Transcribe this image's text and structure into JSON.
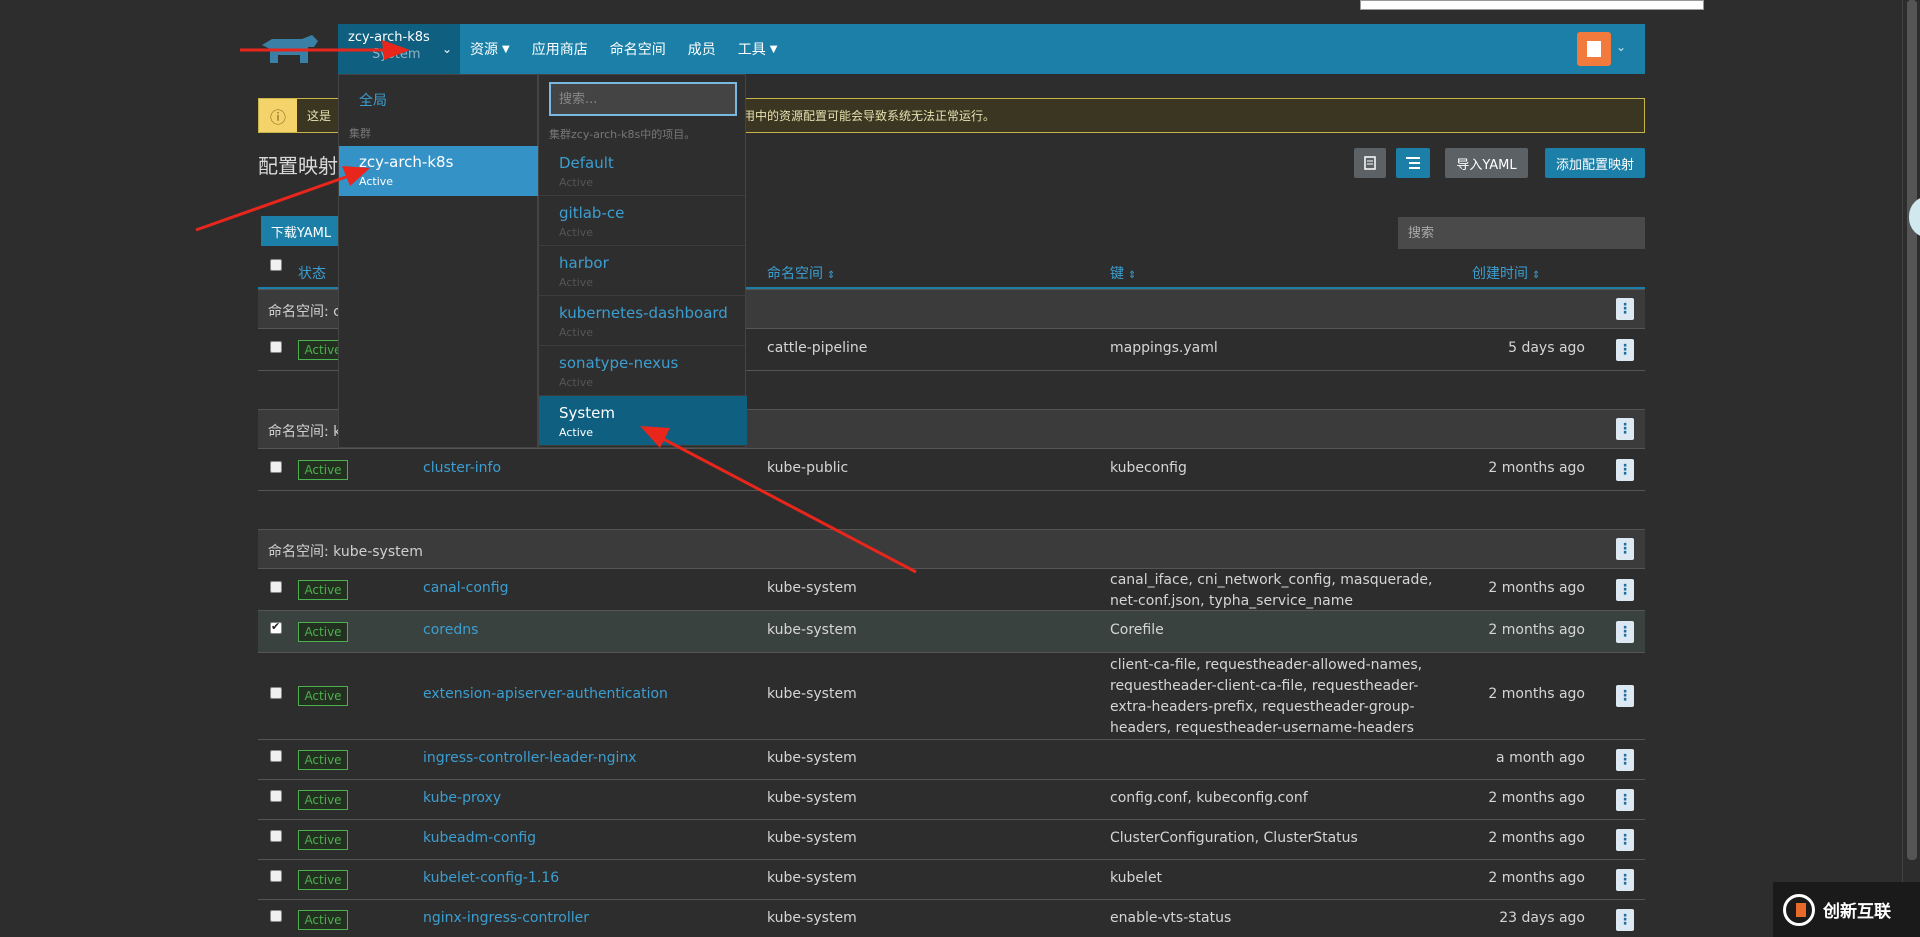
{
  "nav": {
    "cluster_name": "zcy-arch-k8s",
    "project_name": "System",
    "items": [
      {
        "label": "资源",
        "has_dropdown": true
      },
      {
        "label": "应用商店",
        "has_dropdown": false
      },
      {
        "label": "命名空间",
        "has_dropdown": false
      },
      {
        "label": "成员",
        "has_dropdown": false
      },
      {
        "label": "工具",
        "has_dropdown": true
      }
    ],
    "brand_color": "#1b7fa8"
  },
  "banner": {
    "text_prefix": "这是",
    "text_suffix": "用中的资源配置可能会导致系统无法正常运行。",
    "icon": "warning-icon"
  },
  "page": {
    "title": "配置映射",
    "import_yaml": "导入YAML",
    "add_button": "添加配置映射",
    "download_yaml": "下载YAML",
    "search_placeholder": "搜索"
  },
  "table": {
    "headers": {
      "state": "状态",
      "namespace": "命名空间",
      "keys": "键",
      "created": "创建时间"
    },
    "groups": [
      {
        "label": "命名空间: c",
        "rows": [
          {
            "state": "Active",
            "name": "",
            "namespace": "cattle-pipeline",
            "keys": "mappings.yaml",
            "age": "5 days ago",
            "checked": false
          }
        ]
      },
      {
        "label": "命名空间: k",
        "rows": [
          {
            "state": "Active",
            "name": "cluster-info",
            "namespace": "kube-public",
            "keys": "kubeconfig",
            "age": "2 months ago",
            "checked": false
          }
        ]
      },
      {
        "label": "命名空间: kube-system",
        "rows": [
          {
            "state": "Active",
            "name": "canal-config",
            "namespace": "kube-system",
            "keys": "canal_iface, cni_network_config, masquerade, net-conf.json, typha_service_name",
            "age": "2 months ago",
            "checked": false
          },
          {
            "state": "Active",
            "name": "coredns",
            "namespace": "kube-system",
            "keys": "Corefile",
            "age": "2 months ago",
            "checked": true
          },
          {
            "state": "Active",
            "name": "extension-apiserver-authentication",
            "namespace": "kube-system",
            "keys": "client-ca-file, requestheader-allowed-names, requestheader-client-ca-file, requestheader-extra-headers-prefix, requestheader-group-headers, requestheader-username-headers",
            "age": "2 months ago",
            "checked": false
          },
          {
            "state": "Active",
            "name": "ingress-controller-leader-nginx",
            "namespace": "kube-system",
            "keys": "",
            "age": "a month ago",
            "checked": false
          },
          {
            "state": "Active",
            "name": "kube-proxy",
            "namespace": "kube-system",
            "keys": "config.conf, kubeconfig.conf",
            "age": "2 months ago",
            "checked": false
          },
          {
            "state": "Active",
            "name": "kubeadm-config",
            "namespace": "kube-system",
            "keys": "ClusterConfiguration, ClusterStatus",
            "age": "2 months ago",
            "checked": false
          },
          {
            "state": "Active",
            "name": "kubelet-config-1.16",
            "namespace": "kube-system",
            "keys": "kubelet",
            "age": "2 months ago",
            "checked": false
          },
          {
            "state": "Active",
            "name": "nginx-ingress-controller",
            "namespace": "kube-system",
            "keys": "enable-vts-status",
            "age": "23 days ago",
            "checked": false
          }
        ]
      }
    ]
  },
  "dropdown": {
    "global_label": "全局",
    "cluster_section": "集群",
    "active_cluster": {
      "name": "zcy-arch-k8s",
      "status": "Active"
    },
    "search_placeholder": "搜索...",
    "project_section": "集群zcy-arch-k8s中的项目。",
    "projects": [
      {
        "name": "Default",
        "status": "Active",
        "selected": false
      },
      {
        "name": "gitlab-ce",
        "status": "Active",
        "selected": false
      },
      {
        "name": "harbor",
        "status": "Active",
        "selected": false
      },
      {
        "name": "kubernetes-dashboard",
        "status": "Active",
        "selected": false
      },
      {
        "name": "sonatype-nexus",
        "status": "Active",
        "selected": false
      },
      {
        "name": "System",
        "status": "Active",
        "selected": true
      }
    ]
  },
  "watermark": {
    "text": "创新互联"
  }
}
